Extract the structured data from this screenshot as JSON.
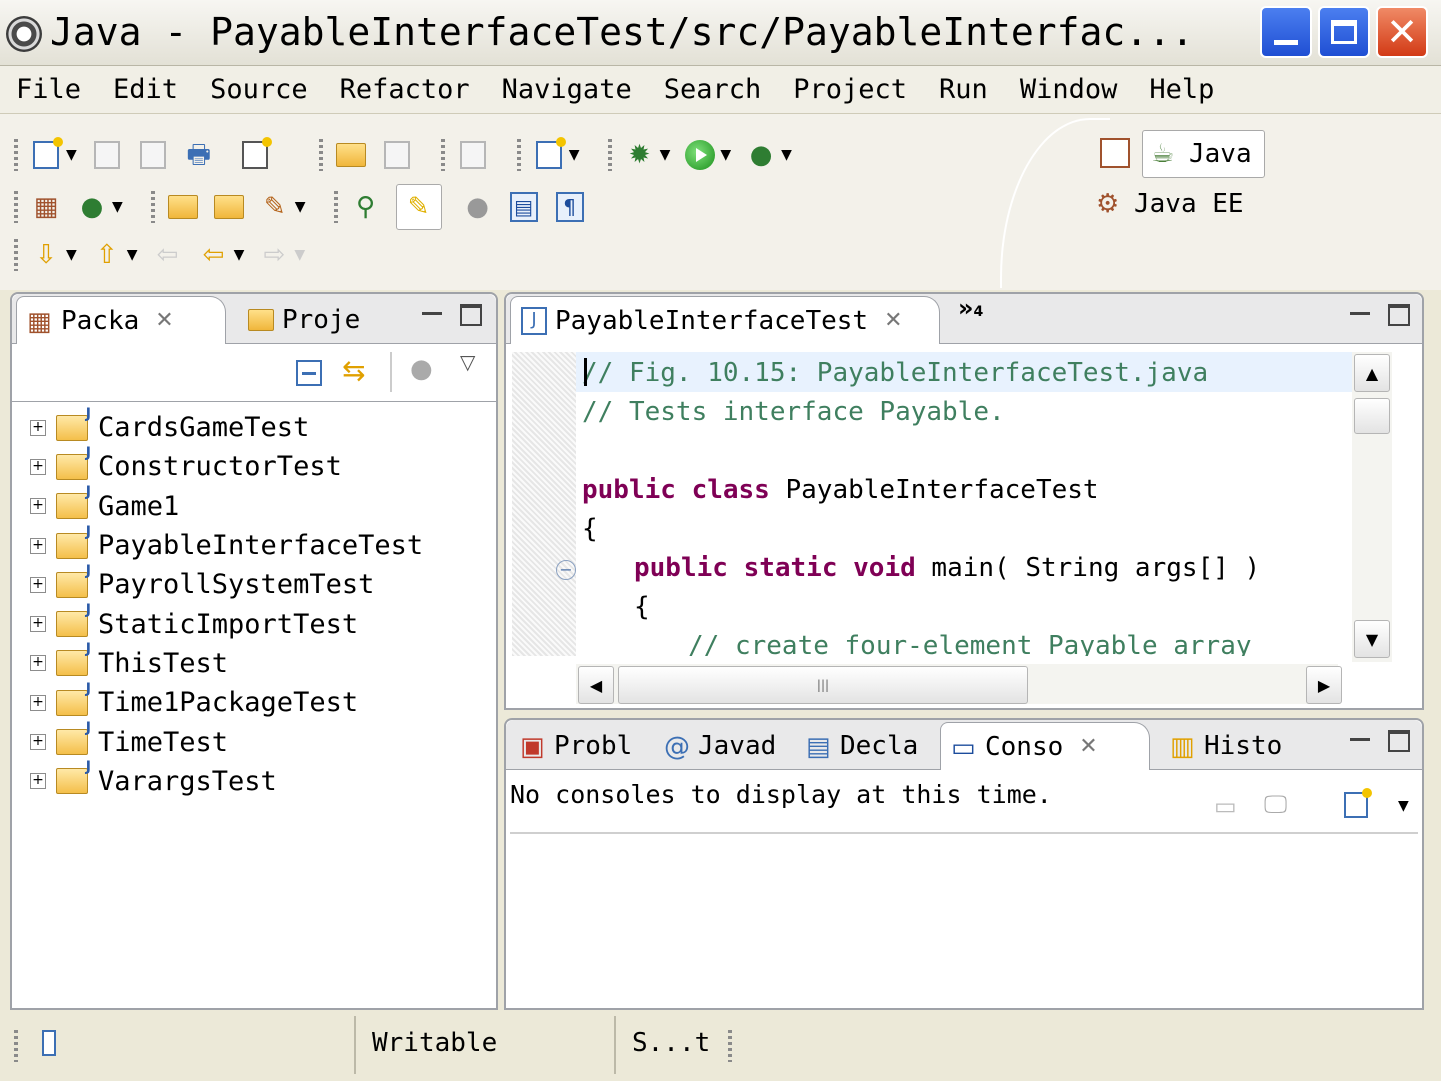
{
  "window": {
    "title": "Java - PayableInterfaceTest/src/PayableInterfac...",
    "controls": {
      "minimize": "_",
      "maximize": "□",
      "close": "✕"
    }
  },
  "menu": [
    "File",
    "Edit",
    "Source",
    "Refactor",
    "Navigate",
    "Search",
    "Project",
    "Run",
    "Window",
    "Help"
  ],
  "perspectives": {
    "java": "Java",
    "java_ee": "Java EE"
  },
  "package_explorer": {
    "tabs": [
      {
        "label": "Packa",
        "active": true
      },
      {
        "label": "Proje",
        "active": false
      }
    ],
    "projects": [
      "CardsGameTest",
      "ConstructorTest",
      "Game1",
      "PayableInterfaceTest",
      "PayrollSystemTest",
      "StaticImportTest",
      "ThisTest",
      "Time1PackageTest",
      "TimeTest",
      "VarargsTest"
    ]
  },
  "editor": {
    "tab_label": "PayableInterfaceTest",
    "overflow_label": "»",
    "overflow_count": "4",
    "code": {
      "line1": "// Fig. 10.15: PayableInterfaceTest.java",
      "line2": "// Tests interface Payable.",
      "line4_kw": "public class",
      "line4_rest": " PayableInterfaceTest",
      "line5": "{",
      "line6_kw": "public static void",
      "line6_rest": " main( String args[] )",
      "line7": "{",
      "line8": "// create four-element Payable array"
    },
    "hscroll_grip": "|||"
  },
  "bottom_panel": {
    "tabs": [
      {
        "label": "Probl",
        "active": false
      },
      {
        "label": "Javad",
        "active": false
      },
      {
        "label": "Decla",
        "active": false
      },
      {
        "label": "Conso",
        "active": true
      },
      {
        "label": "Histo",
        "active": false
      }
    ],
    "javadoc_icon": "@",
    "console_message": "No consoles to display at this time."
  },
  "status": {
    "mode": "Writable",
    "insert": "S...t"
  },
  "colors": {
    "keyword": "#7f0055",
    "comment": "#3f7f5f",
    "close_button": "#d23a15",
    "title_buttons": "#1f4fd3"
  }
}
